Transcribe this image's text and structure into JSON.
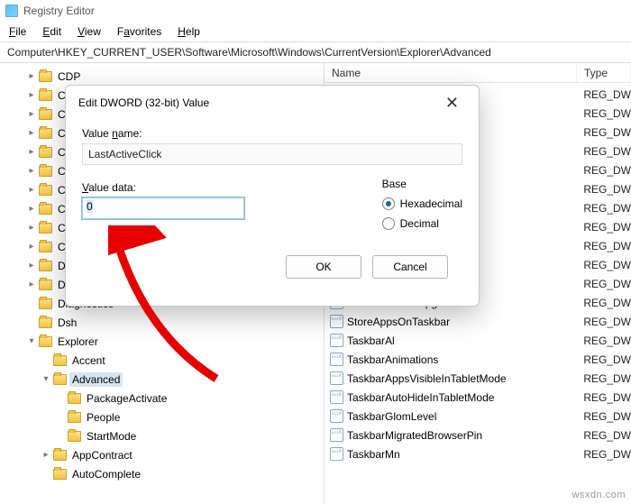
{
  "app": {
    "title": "Registry Editor"
  },
  "menu": {
    "file": "File",
    "edit": "Edit",
    "view": "View",
    "favorites": "Favorites",
    "help": "Help"
  },
  "address": "Computer\\HKEY_CURRENT_USER\\Software\\Microsoft\\Windows\\CurrentVersion\\Explorer\\Advanced",
  "tree": {
    "items": [
      {
        "label": "CDP",
        "indent": 1,
        "state": "closed"
      },
      {
        "label": "Census",
        "indent": 1,
        "state": "closed"
      },
      {
        "label": "ClickNo",
        "indent": 1,
        "state": "closed"
      },
      {
        "label": "CloudE",
        "indent": 1,
        "state": "closed"
      },
      {
        "label": "CloudS",
        "indent": 1,
        "state": "closed"
      },
      {
        "label": "Comm",
        "indent": 1,
        "state": "closed"
      },
      {
        "label": "Conten",
        "indent": 1,
        "state": "closed"
      },
      {
        "label": "Cortana",
        "indent": 1,
        "state": "closed"
      },
      {
        "label": "CPSS",
        "indent": 1,
        "state": "closed"
      },
      {
        "label": "Curate",
        "indent": 1,
        "state": "closed"
      },
      {
        "label": "Device",
        "indent": 1,
        "state": "closed"
      },
      {
        "label": "DeviceS",
        "indent": 1,
        "state": "closed"
      },
      {
        "label": "Diagnostics",
        "indent": 1,
        "state": "leaf"
      },
      {
        "label": "Dsh",
        "indent": 1,
        "state": "leaf"
      },
      {
        "label": "Explorer",
        "indent": 1,
        "state": "open"
      },
      {
        "label": "Accent",
        "indent": 2,
        "state": "leaf"
      },
      {
        "label": "Advanced",
        "indent": 2,
        "state": "open",
        "selected": true
      },
      {
        "label": "PackageActivate",
        "indent": 3,
        "state": "leaf"
      },
      {
        "label": "People",
        "indent": 3,
        "state": "leaf"
      },
      {
        "label": "StartMode",
        "indent": 3,
        "state": "leaf"
      },
      {
        "label": "AppContract",
        "indent": 2,
        "state": "closed"
      },
      {
        "label": "AutoComplete",
        "indent": 2,
        "state": "leaf"
      }
    ]
  },
  "list": {
    "cols": {
      "name": "Name",
      "type": "Type"
    },
    "type_val": "REG_DW",
    "top_count": 11,
    "items": [
      "StartShownOnUpgrade",
      "StoreAppsOnTaskbar",
      "TaskbarAl",
      "TaskbarAnimations",
      "TaskbarAppsVisibleInTabletMode",
      "TaskbarAutoHideInTabletMode",
      "TaskbarGlomLevel",
      "TaskbarMigratedBrowserPin",
      "TaskbarMn"
    ]
  },
  "dialog": {
    "title": "Edit DWORD (32-bit) Value",
    "value_name_label": "Value name:",
    "value_name": "LastActiveClick",
    "value_data_label": "Value data:",
    "value_data": "0",
    "base_label": "Base",
    "hex_label": "Hexadecimal",
    "dec_label": "Decimal",
    "ok": "OK",
    "cancel": "Cancel"
  },
  "watermark": "wsxdn.com"
}
